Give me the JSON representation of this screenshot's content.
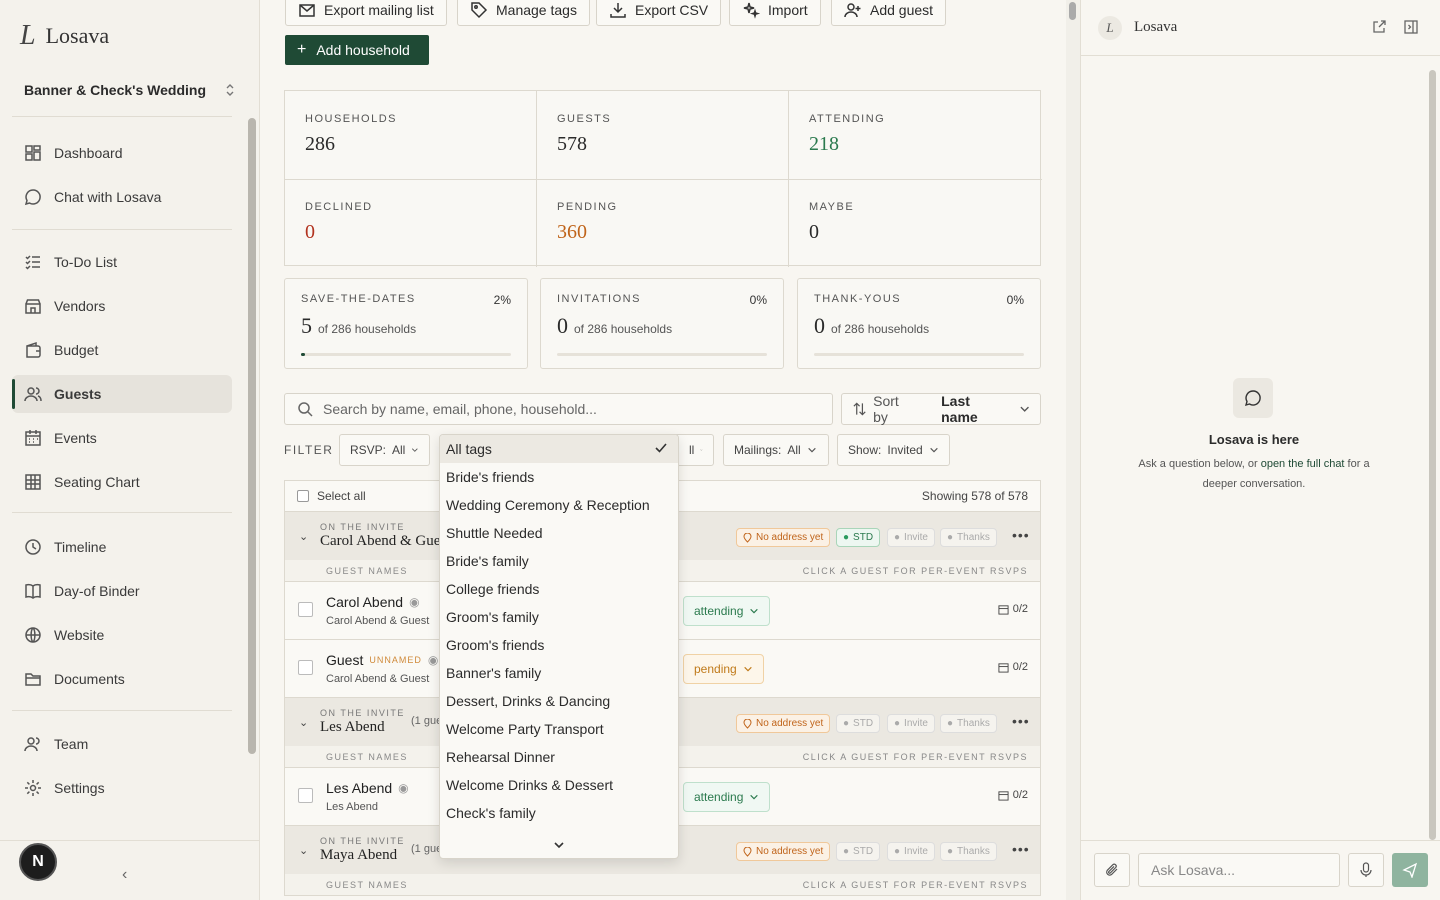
{
  "app": {
    "logo_mark": "L",
    "name": "Losava",
    "wedding": "Banner & Check's Wedding"
  },
  "sidebar": {
    "items": [
      {
        "label": "Dashboard",
        "icon": "dashboard-icon"
      },
      {
        "label": "Chat with Losava",
        "icon": "chat-icon"
      },
      {
        "label": "To-Do List",
        "icon": "todo-icon"
      },
      {
        "label": "Vendors",
        "icon": "store-icon"
      },
      {
        "label": "Budget",
        "icon": "wallet-icon"
      },
      {
        "label": "Guests",
        "icon": "users-icon",
        "active": true
      },
      {
        "label": "Events",
        "icon": "calendar-icon"
      },
      {
        "label": "Seating Chart",
        "icon": "grid-icon"
      },
      {
        "label": "Timeline",
        "icon": "clock-icon"
      },
      {
        "label": "Day-of Binder",
        "icon": "book-icon"
      },
      {
        "label": "Website",
        "icon": "globe-icon"
      },
      {
        "label": "Documents",
        "icon": "folder-icon"
      },
      {
        "label": "Team",
        "icon": "team-icon"
      },
      {
        "label": "Settings",
        "icon": "settings-icon"
      }
    ],
    "avatar": "N"
  },
  "toolbar": {
    "export_mailing": "Export mailing list",
    "manage_tags": "Manage tags",
    "export_csv": "Export CSV",
    "import": "Import",
    "add_guest": "Add guest",
    "add_household": "Add household"
  },
  "stats": [
    {
      "label": "HOUSEHOLDS",
      "value": "286",
      "color": "#2b2b2b"
    },
    {
      "label": "GUESTS",
      "value": "578",
      "color": "#2b2b2b"
    },
    {
      "label": "ATTENDING",
      "value": "218",
      "color": "#2b7a4e"
    },
    {
      "label": "DECLINED",
      "value": "0",
      "color": "#b2331f"
    },
    {
      "label": "PENDING",
      "value": "360",
      "color": "#c0641a"
    },
    {
      "label": "MAYBE",
      "value": "0",
      "color": "#2b2b2b"
    }
  ],
  "progress": [
    {
      "label": "SAVE-THE-DATES",
      "pct": "2%",
      "count": "5",
      "of": "of 286 households",
      "fill": 0.02
    },
    {
      "label": "INVITATIONS",
      "pct": "0%",
      "count": "0",
      "of": "of 286 households",
      "fill": 0
    },
    {
      "label": "THANK-YOUS",
      "pct": "0%",
      "count": "0",
      "of": "of 286 households",
      "fill": 0
    }
  ],
  "search": {
    "placeholder": "Search by name, email, phone, household..."
  },
  "sort": {
    "label": "Sort by",
    "value": "Last name"
  },
  "filter": {
    "label": "FILTER",
    "rsvp": "RSVP:",
    "rsvp_val": "All",
    "tags_val": "ll",
    "mailings": "Mailings:",
    "mailings_val": "All",
    "show": "Show:",
    "show_val": "Invited"
  },
  "list": {
    "select_all": "Select all",
    "showing": "Showing 578 of 578"
  },
  "households": [
    {
      "on_invite": "ON THE INVITE",
      "name": "Carol Abend & Guest",
      "count": "",
      "std_on": true
    },
    {
      "on_invite": "ON THE INVITE",
      "name": "Les Abend",
      "count": "(1 gue",
      "std_on": false
    },
    {
      "on_invite": "ON THE INVITE",
      "name": "Maya Abend",
      "count": "(1 gue",
      "std_on": false
    }
  ],
  "badges": {
    "address": "No address yet",
    "std": "STD",
    "invite": "Invite",
    "thanks": "Thanks"
  },
  "guest_names_label": "GUEST NAMES",
  "click_hint": "CLICK A GUEST FOR PER-EVENT RSVPS",
  "guests": [
    {
      "name": "Carol Abend",
      "sub": "Carol Abend & Guest",
      "rsvp": "attending",
      "events": "0/2"
    },
    {
      "name": "Guest",
      "tag": "UNNAMED",
      "sub": "Carol Abend & Guest",
      "rsvp": "pending",
      "events": "0/2"
    },
    {
      "name": "Les Abend",
      "sub": "Les Abend",
      "rsvp": "attending",
      "events": "0/2"
    }
  ],
  "tags_dropdown": {
    "options": [
      "All tags",
      "Bride's friends",
      "Wedding Ceremony & Reception",
      "Shuttle Needed",
      "Bride's family",
      "College friends",
      "Groom's family",
      "Groom's friends",
      "Banner's family",
      "Dessert, Drinks & Dancing",
      "Welcome Party Transport",
      "Rehearsal Dinner",
      "Welcome Drinks & Dessert",
      "Check's family"
    ],
    "selected": "All tags"
  },
  "panel": {
    "title": "Losava",
    "here": "Losava is here",
    "hint_pre": "Ask a question below, or ",
    "hint_link": "open the full chat",
    "hint_post": " for a deeper conversation.",
    "ask_placeholder": "Ask Losava..."
  }
}
